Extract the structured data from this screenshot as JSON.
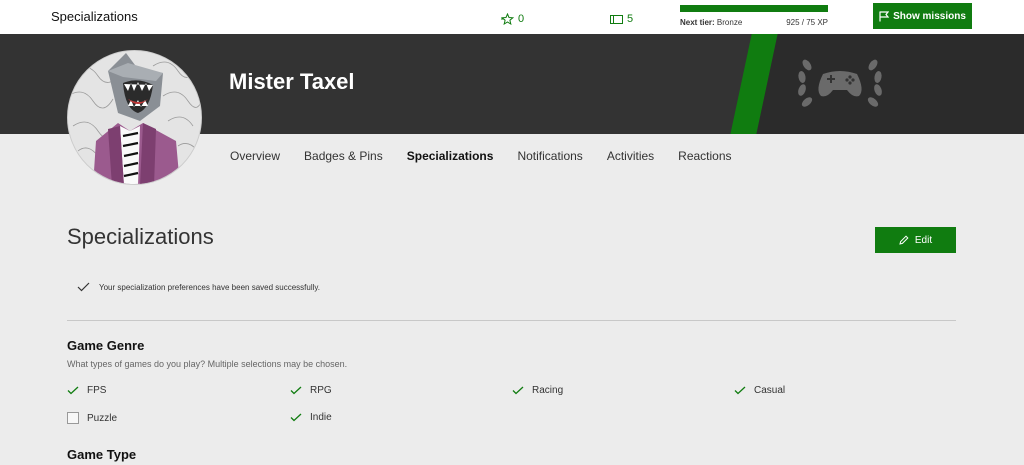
{
  "topbar": {
    "title": "Specializations",
    "stars": "0",
    "tickets": "5",
    "next_tier_label": "Next tier:",
    "next_tier_value": "Bronze",
    "xp_text": "925 / 75 XP",
    "xp_progress": 1.0,
    "missions_label": "Show missions"
  },
  "profile": {
    "gamertag": "Mister Taxel"
  },
  "tabs": [
    {
      "label": "Overview",
      "active": false
    },
    {
      "label": "Badges & Pins",
      "active": false
    },
    {
      "label": "Specializations",
      "active": true
    },
    {
      "label": "Notifications",
      "active": false
    },
    {
      "label": "Activities",
      "active": false
    },
    {
      "label": "Reactions",
      "active": false
    }
  ],
  "main": {
    "heading": "Specializations",
    "edit_label": "Edit",
    "notice": "Your specialization preferences have been saved successfully."
  },
  "genre": {
    "title": "Game Genre",
    "description": "What types of games do you play? Multiple selections may be chosen.",
    "options": [
      {
        "label": "FPS",
        "checked": true
      },
      {
        "label": "RPG",
        "checked": true
      },
      {
        "label": "Racing",
        "checked": true
      },
      {
        "label": "Casual",
        "checked": true
      },
      {
        "label": "Puzzle",
        "checked": false
      },
      {
        "label": "Indie",
        "checked": true
      }
    ]
  },
  "type_section": {
    "title": "Game Type"
  },
  "colors": {
    "accent": "#107c10",
    "banner": "#333333",
    "page_bg": "#ececec"
  }
}
